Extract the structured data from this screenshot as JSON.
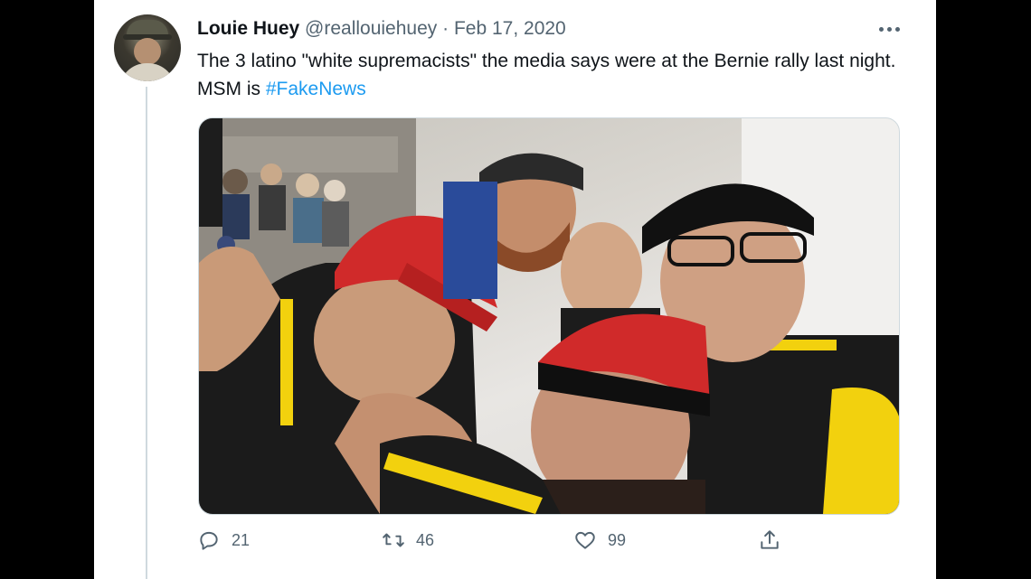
{
  "tweet": {
    "display_name": "Louie Huey",
    "handle": "@reallouiehuey",
    "separator": "·",
    "date": "Feb 17, 2020",
    "text_before": "The 3 latino \"white supremacists\" the media says were at the Bernie rally last night. MSM is ",
    "hashtag": "#FakeNews"
  },
  "actions": {
    "replies": "21",
    "retweets": "46",
    "likes": "99"
  },
  "icons": {
    "avatar": "profile-photo",
    "more": "ellipsis-icon",
    "reply": "reply-icon",
    "retweet": "retweet-icon",
    "like": "heart-icon",
    "share": "share-icon"
  },
  "colors": {
    "hashtag": "#1d9bf0",
    "meta": "#536471",
    "text": "#0f1419",
    "cap_red": "#d02a2a",
    "jacket_yellow": "#f2d10e"
  }
}
